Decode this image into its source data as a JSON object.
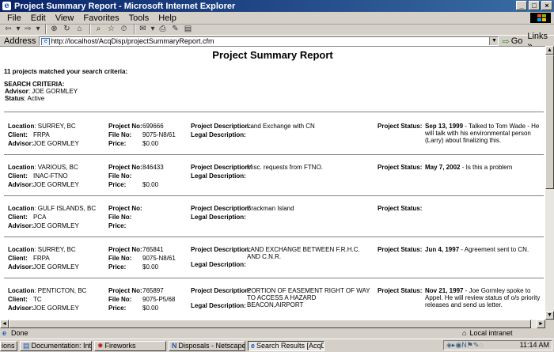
{
  "window": {
    "title": "Project Summary Report - Microsoft Internet Explorer",
    "ie_glyph": "e",
    "min_glyph": "_",
    "max_glyph": "□",
    "close_glyph": "×"
  },
  "menu": [
    "File",
    "Edit",
    "View",
    "Favorites",
    "Tools",
    "Help"
  ],
  "toolbar": {
    "back_icon": "back-arrow-icon",
    "forward_icon": "forward-arrow-icon",
    "glyphs": [
      "⇦",
      "▾",
      "⇨",
      "▾",
      "⊗",
      "↻",
      "⌂",
      "⌕",
      "☆",
      "⏲",
      "✉",
      "▾",
      "⎙",
      "✎",
      "▤"
    ]
  },
  "address": {
    "label": "Address",
    "url": "http://localhost/AcqDisp/projectSummaryReport.cfm",
    "page_glyph": "e",
    "dropdown_glyph": "▼",
    "go_glyph": "⇨",
    "go_label": "Go",
    "links_label": "Links",
    "links_glyph": "»"
  },
  "report": {
    "title": "Project Summary Report",
    "matched": "11 projects matched your search criteria:",
    "criteria_heading": "SEARCH CRITERIA:",
    "criteria_advisor_label": "Advisor",
    "criteria_advisor_value": ": JOE GORMLEY",
    "criteria_status_label": "Status",
    "criteria_status_value": ": Active",
    "labels": {
      "location": "Location",
      "client": "Client:",
      "advisor": "Advisor:",
      "project_no": "Project No:",
      "file_no": "File No:",
      "price": "Price:",
      "project_description": "Project Description:",
      "legal_description": "Legal Description:",
      "project_status": "Project Status:"
    },
    "projects": [
      {
        "location": ": SURREY, BC",
        "client": "FRPA",
        "advisor": "JOE GORMLEY",
        "project_no": "699666",
        "file_no": "9075-N8/61",
        "price": "$0.00",
        "description": "Land Exchange with CN",
        "status_date": "Sep 13, 1999",
        "status_text": " - Talked to Tom Wade - He will talk with his environmental person (Larry) about finalizing this."
      },
      {
        "location": ": VARIOUS, BC",
        "client": "INAC-FTNO",
        "advisor": "JOE GORMLEY",
        "project_no": "846433",
        "file_no": "",
        "price": "$0.00",
        "description": "Misc. requests from FTNO.",
        "status_date": "May 7, 2002",
        "status_text": " - Is this a problem"
      },
      {
        "location": ": GULF ISLANDS, BC",
        "client": "PCA",
        "advisor": "JOE GORMLEY",
        "project_no": "",
        "file_no": "",
        "price": "",
        "description": "Brackman Island",
        "status_date": "",
        "status_text": ""
      },
      {
        "location": ": SURREY, BC",
        "client": "FRPA",
        "advisor": "JOE GORMLEY",
        "project_no": "765841",
        "file_no": "9075-N8/61",
        "price": "$0.00",
        "description": "LAND EXCHANGE BETWEEN F.R.H.C. AND C.N.R.",
        "status_date": "Jun 4, 1997",
        "status_text": " - Agreement sent to CN."
      },
      {
        "location": ": PENTICTON, BC",
        "client": "TC",
        "advisor": "JOE GORMLEY",
        "project_no": "765897",
        "file_no": "9075-P5/68",
        "price": "$0.00",
        "description": "PORTION OF EASEMENT RIGHT OF WAY TO ACCESS A HAZARD BEACON,AIRPORT",
        "status_date": "Nov 21, 1997",
        "status_text": " - Joe Gormley spoke to Appel. He will review status of o/s priority releases and send us letter."
      }
    ]
  },
  "status": {
    "text": "Done",
    "zone": "Local intranet",
    "done_glyph": "e",
    "zone_glyph": "⌂"
  },
  "taskbar": {
    "items": [
      {
        "label": "ions",
        "glyph": ""
      },
      {
        "label": "Documentation: Interface [...",
        "glyph": "▤"
      },
      {
        "label": "Fireworks",
        "glyph": "✹"
      },
      {
        "label": "Disposals - Netscape",
        "glyph": "N"
      },
      {
        "label": "Search Results [AcqDisp/...",
        "glyph": "e"
      }
    ],
    "time": "11:14 AM",
    "tray_glyphs": "◈▸◉N⚑✎◌"
  },
  "scroll": {
    "up": "▲",
    "down": "▼",
    "left": "◄",
    "right": "►"
  },
  "colors": {
    "title_bar": "#0a246a",
    "window_bg": "#d4d0c8",
    "content_bg": "#ffffff"
  }
}
